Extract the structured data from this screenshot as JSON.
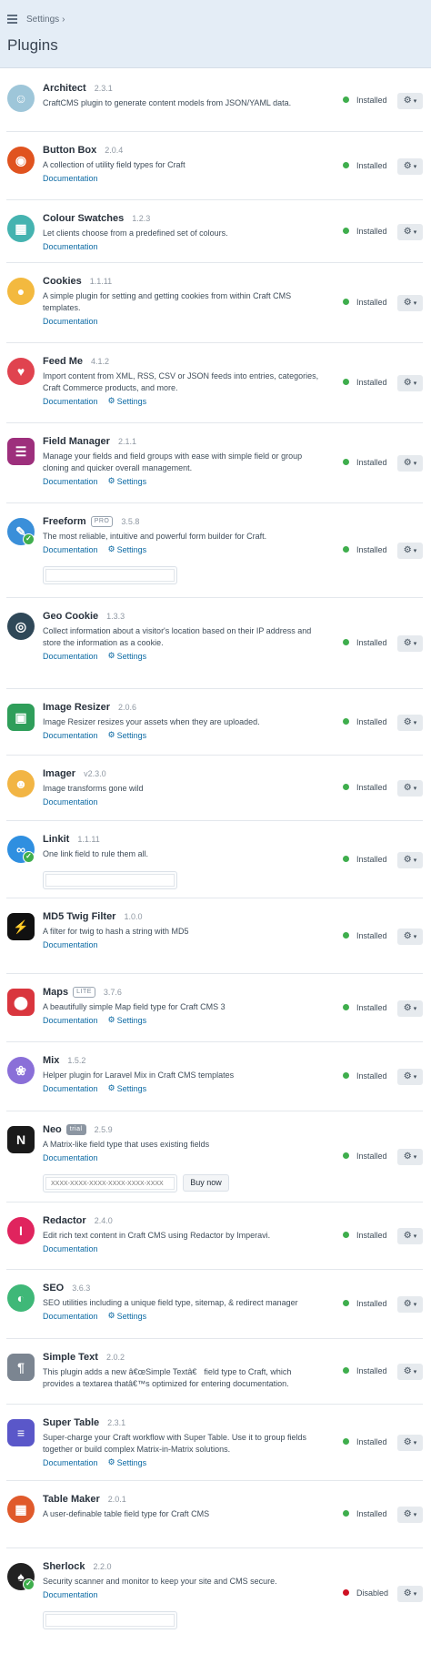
{
  "header": {
    "breadcrumb": "Settings",
    "breadcrumb_sep": "›",
    "title": "Plugins"
  },
  "colors": {
    "installed": "#3fae4d",
    "disabled": "#cf1124",
    "link": "#0b69a3",
    "header_bg": "#e4edf6"
  },
  "common": {
    "documentation": "Documentation",
    "settings": "Settings",
    "buy_now": "Buy now",
    "gear_icon": "⚙",
    "chevron_icon": "▾",
    "settings_icon": "⚙",
    "license_placeholder": "XXXX-XXXX-XXXX-XXXX-XXXX-XXXX"
  },
  "plugins": [
    {
      "name": "Architect",
      "version": "2.3.1",
      "edition": "",
      "description": [
        "CraftCMS plugin to generate content models from JSON/YAML data."
      ],
      "documentation": false,
      "settings": false,
      "license_field": false,
      "status": "Installed",
      "status_color": "#3fae4d",
      "icon": "architect-avatar-icon",
      "icon_color": "#9ec6d9"
    },
    {
      "name": "Button Box",
      "version": "2.0.4",
      "edition": "",
      "description": [
        "A collection of utility field types for Craft"
      ],
      "documentation": true,
      "settings": false,
      "license_field": false,
      "status": "Installed",
      "status_color": "#3fae4d",
      "icon": "button-box-icon",
      "icon_color": "#e0531f"
    },
    {
      "name": "Colour Swatches",
      "version": "1.2.3",
      "edition": "",
      "description": [
        "Let clients choose from a predefined set of colours."
      ],
      "documentation": true,
      "settings": false,
      "license_field": false,
      "status": "Installed",
      "status_color": "#3fae4d",
      "icon": "colour-swatches-icon",
      "icon_color": "#45b3b0"
    },
    {
      "name": "Cookies",
      "version": "1.1.11",
      "edition": "",
      "description": [
        "A simple plugin for setting and getting cookies from within Craft CMS",
        "templates."
      ],
      "documentation": true,
      "settings": false,
      "license_field": false,
      "status": "Installed",
      "status_color": "#3fae4d",
      "icon": "cookie-icon",
      "icon_color": "#f3b93f"
    },
    {
      "name": "Feed Me",
      "version": "4.1.2",
      "edition": "",
      "description": [
        "Import content from XML, RSS, CSV or JSON feeds into entries, categories,",
        "Craft Commerce products, and more."
      ],
      "documentation": true,
      "settings": true,
      "license_field": false,
      "status": "Installed",
      "status_color": "#3fae4d",
      "icon": "feed-me-icon",
      "icon_color": "#e0434f"
    },
    {
      "name": "Field Manager",
      "version": "2.1.1",
      "edition": "",
      "description": [
        "Manage your fields and field groups with ease with simple field or group",
        "cloning and quicker overall management."
      ],
      "documentation": true,
      "settings": true,
      "license_field": false,
      "status": "Installed",
      "status_color": "#3fae4d",
      "icon": "field-manager-icon",
      "icon_color": "#9d2f7c"
    },
    {
      "name": "Freeform",
      "version": "3.5.8",
      "edition": "PRO",
      "description": [
        "The most reliable, intuitive and powerful form builder for Craft."
      ],
      "documentation": true,
      "settings": true,
      "license_field": true,
      "status": "Installed",
      "status_color": "#3fae4d",
      "icon": "freeform-icon",
      "icon_color": "#3a8fd9"
    },
    {
      "name": "Geo Cookie",
      "version": "1.3.3",
      "edition": "",
      "description": [
        "Collect information about a visitor's location based on their IP address and",
        "store the information as a cookie."
      ],
      "documentation": true,
      "settings": true,
      "license_field": false,
      "status": "Installed",
      "status_color": "#3fae4d",
      "icon": "geo-cookie-icon",
      "icon_color": "#2f4858"
    },
    {
      "name": "Image Resizer",
      "version": "2.0.6",
      "edition": "",
      "description": [
        "Image Resizer resizes your assets when they are uploaded."
      ],
      "documentation": true,
      "settings": true,
      "license_field": false,
      "status": "Installed",
      "status_color": "#3fae4d",
      "icon": "image-resizer-icon",
      "icon_color": "#2f9e5a"
    },
    {
      "name": "Imager",
      "version": "v2.3.0",
      "edition": "",
      "description": [
        "Image transforms gone wild"
      ],
      "documentation": true,
      "settings": false,
      "license_field": false,
      "status": "Installed",
      "status_color": "#3fae4d",
      "icon": "imager-worker-icon",
      "icon_color": "#f2b544"
    },
    {
      "name": "Linkit",
      "version": "1.1.11",
      "edition": "",
      "description": [
        "One link field to rule them all."
      ],
      "documentation": false,
      "settings": false,
      "license_field": true,
      "status": "Installed",
      "status_color": "#3fae4d",
      "icon": "linkit-icon",
      "icon_color": "#2f8fe0"
    },
    {
      "name": "MD5 Twig Filter",
      "version": "1.0.0",
      "edition": "",
      "description": [
        "A filter for twig to hash a string with MD5"
      ],
      "documentation": true,
      "settings": false,
      "license_field": false,
      "status": "Installed",
      "status_color": "#3fae4d",
      "icon": "plug-icon",
      "icon_color": "#111111"
    },
    {
      "name": "Maps",
      "version": "3.7.6",
      "edition": "LITE",
      "description": [
        "A beautifully simple Map field type for Craft CMS 3"
      ],
      "documentation": true,
      "settings": true,
      "license_field": false,
      "status": "Installed",
      "status_color": "#3fae4d",
      "icon": "map-pin-icon",
      "icon_color": "#d9363e"
    },
    {
      "name": "Mix",
      "version": "1.5.2",
      "edition": "",
      "description": [
        "Helper plugin for Laravel Mix in Craft CMS templates"
      ],
      "documentation": true,
      "settings": true,
      "license_field": false,
      "status": "Installed",
      "status_color": "#3fae4d",
      "icon": "mix-circles-icon",
      "icon_color": "#8a6fd8"
    },
    {
      "name": "Neo",
      "version": "2.5.9",
      "edition": "trial",
      "description": [
        "A Matrix-like field type that uses existing fields"
      ],
      "documentation": true,
      "settings": false,
      "license_field": true,
      "status": "Installed",
      "status_color": "#3fae4d",
      "icon": "neo-logo-icon",
      "icon_color": "#1a1a1a"
    },
    {
      "name": "Redactor",
      "version": "2.4.0",
      "edition": "",
      "description": [
        "Edit rich text content in Craft CMS using Redactor by Imperavi."
      ],
      "documentation": true,
      "settings": false,
      "license_field": false,
      "status": "Installed",
      "status_color": "#3fae4d",
      "icon": "redactor-icon",
      "icon_color": "#e0245e"
    },
    {
      "name": "SEO",
      "version": "3.6.3",
      "edition": "",
      "description": [
        "SEO utilities including a unique field type, sitemap, & redirect manager"
      ],
      "documentation": true,
      "settings": true,
      "license_field": false,
      "status": "Installed",
      "status_color": "#3fae4d",
      "icon": "seo-icon",
      "icon_color": "#3fb878"
    },
    {
      "name": "Simple Text",
      "version": "2.0.2",
      "edition": "",
      "description": [
        "This plugin adds a new â€œSimple Textâ€ field type to Craft, which",
        "provides a textarea thatâ€™s optimized for entering documentation."
      ],
      "documentation": false,
      "settings": false,
      "license_field": false,
      "status": "Installed",
      "status_color": "#3fae4d",
      "icon": "simple-text-icon",
      "icon_color": "#7b8591"
    },
    {
      "name": "Super Table",
      "version": "2.3.1",
      "edition": "",
      "description": [
        "Super-charge your Craft workflow with Super Table. Use it to group fields",
        "together or build complex Matrix-in-Matrix solutions."
      ],
      "documentation": true,
      "settings": true,
      "license_field": false,
      "status": "Installed",
      "status_color": "#3fae4d",
      "icon": "super-table-icon",
      "icon_color": "#5a57c9"
    },
    {
      "name": "Table Maker",
      "version": "2.0.1",
      "edition": "",
      "description": [
        "A user-definable table field type for Craft CMS"
      ],
      "documentation": false,
      "settings": false,
      "license_field": false,
      "status": "Installed",
      "status_color": "#3fae4d",
      "icon": "table-maker-icon",
      "icon_color": "#e05a2b"
    },
    {
      "name": "Sherlock",
      "version": "2.2.0",
      "edition": "",
      "description": [
        "Security scanner and monitor to keep your site and CMS secure."
      ],
      "documentation": true,
      "settings": false,
      "license_field": true,
      "status": "Disabled",
      "status_color": "#cf1124",
      "icon": "sherlock-detective-icon",
      "icon_color": "#222222"
    }
  ]
}
